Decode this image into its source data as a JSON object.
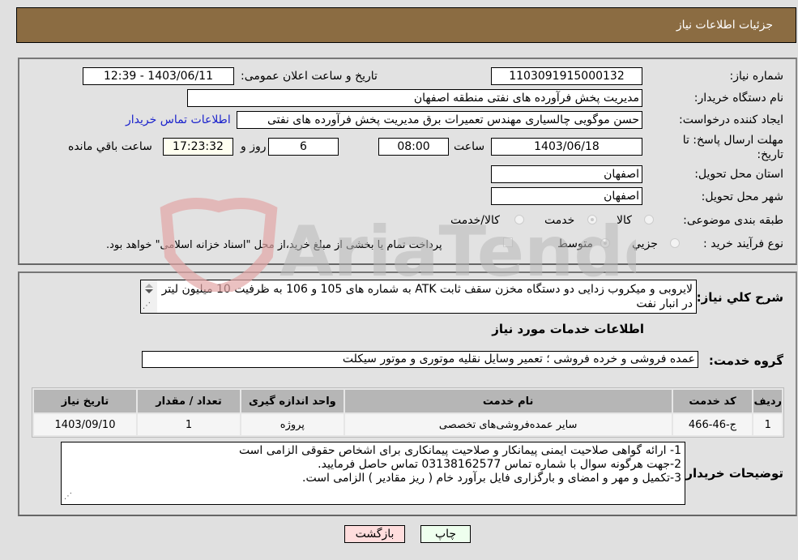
{
  "header": {
    "title": "جزئیات اطلاعات نیاز"
  },
  "details": {
    "need_number_label": "شماره نیاز:",
    "need_number": "1103091915000132",
    "announce_label": "تاریخ و ساعت اعلان عمومی:",
    "announce_value": "1403/06/11 - 12:39",
    "buyer_org_label": "نام دستگاه خریدار:",
    "buyer_org": "مدیریت پخش فرآورده های نفتی منطقه اصفهان",
    "requester_label": "ایجاد کننده درخواست:",
    "requester": "حسن موگویی چالسیاری مهندس تعمیرات برق مدیریت پخش فرآورده های نفتی",
    "contact_link": "اطلاعات تماس خریدار",
    "deadline_label": "مهلت ارسال پاسخ: تا تاریخ:",
    "deadline_date": "1403/06/18",
    "time_label": "ساعت",
    "deadline_time": "08:00",
    "days_value": "6",
    "days_label": "روز و",
    "remaining_time": "17:23:32",
    "remaining_label": "ساعت باقي مانده",
    "province_label": "استان محل تحویل:",
    "province": "اصفهان",
    "city_label": "شهر محل تحویل:",
    "city": "اصفهان",
    "category_label": "طبقه بندی موضوعی:",
    "category_options": [
      "کالا",
      "خدمت",
      "کالا/خدمت"
    ],
    "category_selected": "خدمت",
    "process_label": "نوع فرآیند خرید :",
    "process_options": [
      "جزیي",
      "متوسط"
    ],
    "process_selected": "متوسط",
    "treasury_note": "پرداخت تمام یا بخشی از مبلغ خرید،از محل \"اسناد خزانه اسلامی\" خواهد بود."
  },
  "description": {
    "label": "شرح کلي نیاز:",
    "text": "لایروبی و میکروب زدایی دو دستگاه مخزن سقف ثابت ATK به شماره های 105 و 106 به ظرفیت 10 میلیون لیتر در انبار نفت"
  },
  "services": {
    "section_title": "اطلاعات خدمات مورد نیاز",
    "group_label": "گروه خدمت:",
    "group_value": "عمده فروشی و خرده فروشی ؛ تعمیر وسایل نقلیه موتوری و موتور سیکلت",
    "columns": [
      "ردیف",
      "کد خدمت",
      "نام خدمت",
      "واحد اندازه گیری",
      "تعداد / مقدار",
      "تاریخ نیاز"
    ],
    "rows": [
      [
        "1",
        "ج-46-466",
        "سایر عمده‌فروشی‌های تخصصی",
        "پروژه",
        "1",
        "1403/09/10"
      ]
    ]
  },
  "buyer_notes": {
    "label": "توضیحات خریدار:",
    "lines": [
      "1- ارائه گواهی صلاحیت ایمنی پیمانکار و صلاحیت پیمانکاری برای اشخاص حقوقی الزامی است",
      "2-جهت هرگونه سوال با شماره تماس 03138162577 تماس حاصل فرمایید.",
      "3-تکمیل و مهر و امضای و بارگزاری فایل برآورد خام ( ریز مقادیر ) الزامی است."
    ]
  },
  "buttons": {
    "print": "چاپ",
    "back": "بازگشت"
  },
  "watermark": {
    "text": "AriaTender.neT"
  },
  "colors": {
    "header_bg": "#8b6c42",
    "print_bg": "#eeffee",
    "back_bg": "#ffdddd",
    "link": "#1a22cc",
    "remaining_bg": "#fffff0"
  }
}
